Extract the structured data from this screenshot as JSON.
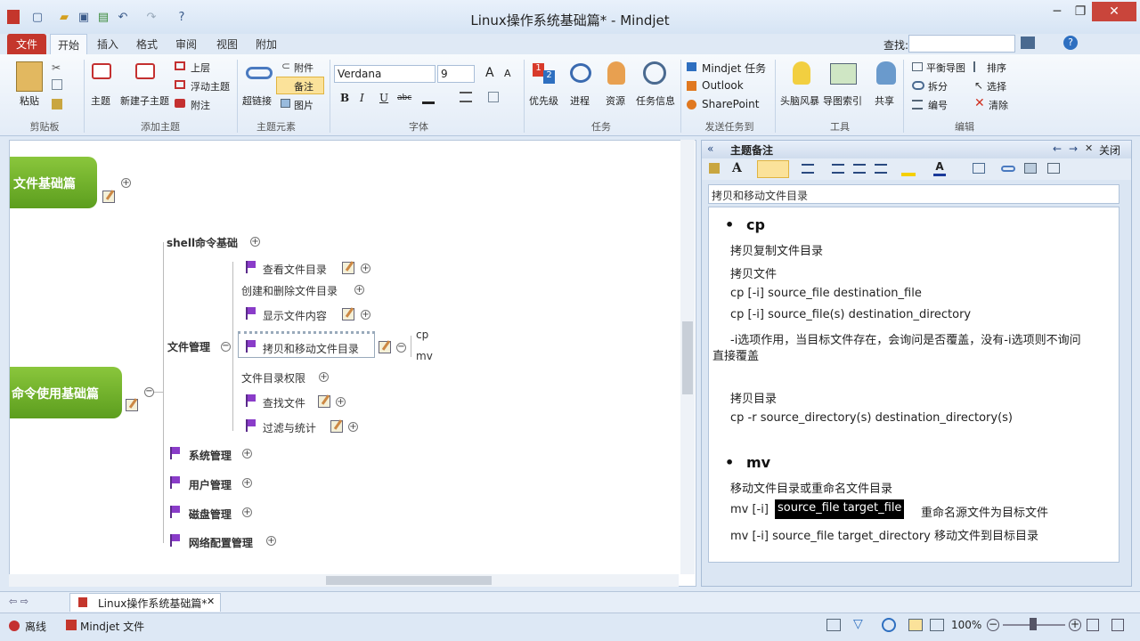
{
  "window": {
    "title": "Linux操作系统基础篇* - Mindjet",
    "min": "─",
    "max": "❐",
    "close": "✕"
  },
  "tabs": [
    "文件",
    "开始",
    "插入",
    "格式",
    "审阅",
    "视图",
    "附加"
  ],
  "search": {
    "label": "查找:",
    "value": ""
  },
  "ribbon": {
    "clipboard": {
      "group": "剪贴板",
      "paste": "粘贴"
    },
    "add_topic": {
      "group": "添加主题",
      "topic": "主题",
      "subtopic": "新建子主题",
      "upper": "上层",
      "floating": "浮动主题",
      "callout": "附注"
    },
    "topic_elements": {
      "group": "主题元素",
      "hyperlink": "超链接",
      "attachment": "附件",
      "notes": "备注",
      "image": "图片"
    },
    "font": {
      "group": "字体",
      "family": "Verdana",
      "size": "9",
      "bold": "B",
      "italic": "I",
      "underline": "U",
      "strike": "abc",
      "grow": "A",
      "shrink": "A"
    },
    "tasks": {
      "group": "任务",
      "priority": "优先级",
      "progress": "进程",
      "resources": "资源",
      "task_info": "任务信息"
    },
    "send": {
      "group": "发送任务到",
      "mindjet": "Mindjet 任务",
      "outlook": "Outlook",
      "sharepoint": "SharePoint"
    },
    "tools": {
      "group": "工具",
      "brainstorm": "头脑风暴",
      "map_index": "导图索引",
      "share": "共享"
    },
    "edit": {
      "group": "编辑",
      "balance": "平衡导图",
      "sort": "排序",
      "split": "拆分",
      "select": "选择",
      "number": "编号",
      "clear": "清除"
    }
  },
  "map": {
    "central_top": "文件基础篇",
    "central_main": "命令使用基础篇",
    "shell": "shell命令基础",
    "file_mgmt": "文件管理",
    "children": [
      "查看文件目录",
      "创建和删除文件目录",
      "显示文件内容",
      "拷贝和移动文件目录",
      "文件目录权限",
      "查找文件",
      "过滤与统计"
    ],
    "leaf": [
      "cp",
      "mv"
    ],
    "others": [
      "系统管理",
      "用户管理",
      "磁盘管理",
      "网络配置管理"
    ]
  },
  "notes_panel": {
    "title": "主题备注",
    "close": "关闭",
    "topic": "拷贝和移动文件目录",
    "cp_head": "cp",
    "cp_lines": [
      "拷贝复制文件目录",
      "拷贝文件",
      "cp [-i] source_file destination_file",
      "cp [-i] source_file(s) destination_directory",
      "-i选项作用，当目标文件存在，会询问是否覆盖，没有-i选项则不询问",
      "直接覆盖",
      "拷贝目录",
      "cp -r source_directory(s) destination_directory(s)"
    ],
    "mv_head": "mv",
    "mv_lines": [
      "移动文件目录或重命名文件目录",
      "mv [-i] ",
      "source_file target_file",
      "重命名源文件为目标文件",
      "mv [-i] source_file target_directory 移动文件到目标目录"
    ]
  },
  "doc_tab": "Linux操作系统基础篇*",
  "status": {
    "offline": "离线",
    "mindjet_files": "Mindjet 文件",
    "zoom": "100%"
  },
  "colors": {
    "file_tab": "#c4362c",
    "topic_green": "#6fae29",
    "flag": "#8a3cc9"
  }
}
